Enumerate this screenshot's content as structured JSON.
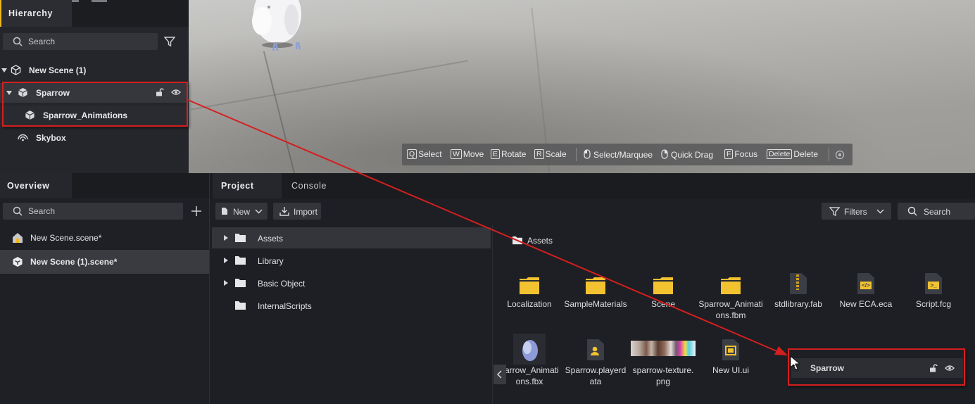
{
  "hierarchy": {
    "tab_label": "Hierarchy",
    "search_placeholder": "Search",
    "scene_root": "New Scene (1)",
    "items": [
      {
        "label": "Sparrow",
        "icon": "cube-icon",
        "expanded": true
      },
      {
        "label": "Sparrow_Animations",
        "icon": "cube-icon"
      },
      {
        "label": "Skybox",
        "icon": "skybox-icon"
      }
    ]
  },
  "scene_toolbar": {
    "items": [
      {
        "key": "Q",
        "label": "Select"
      },
      {
        "key": "W",
        "label": "Move"
      },
      {
        "key": "E",
        "label": "Rotate"
      },
      {
        "key": "R",
        "label": "Scale"
      },
      {
        "key": "",
        "label": "Select/Marquee",
        "icon": "mouse-left-icon"
      },
      {
        "key": "",
        "label": "Quick Drag",
        "icon": "mouse-right-icon"
      },
      {
        "key": "F",
        "label": "Focus"
      },
      {
        "key": "Delete",
        "label": "Delete"
      }
    ]
  },
  "overview": {
    "tab_label": "Overview",
    "search_placeholder": "Search",
    "scenes": [
      {
        "label": "New Scene.scene*",
        "icon": "house-icon",
        "selected": false
      },
      {
        "label": "New Scene (1).scene*",
        "icon": "scene-cube-icon",
        "selected": true
      }
    ]
  },
  "project": {
    "tabs": [
      "Project",
      "Console"
    ],
    "new_label": "New",
    "import_label": "Import",
    "filters_label": "Filters",
    "search_label": "Search",
    "folders": [
      {
        "label": "Assets",
        "expandable": true,
        "selected": true
      },
      {
        "label": "Library",
        "expandable": true
      },
      {
        "label": "Basic Object",
        "expandable": true
      },
      {
        "label": "InternalScripts",
        "expandable": false
      }
    ],
    "breadcrumb": "Assets",
    "grid_row1": [
      {
        "label": "Localization",
        "icon": "folder-icon"
      },
      {
        "label": "SampleMaterials",
        "icon": "folder-icon"
      },
      {
        "label": "Scene",
        "icon": "folder-icon"
      },
      {
        "label": "Sparrow_Animati",
        "label2": "ons.fbm",
        "icon": "folder-icon"
      },
      {
        "label": "stdlibrary.fab",
        "icon": "zip-file-icon"
      },
      {
        "label": "New ECA.eca",
        "icon": "eca-file-icon"
      },
      {
        "label": "Script.fcg",
        "icon": "script-file-icon"
      }
    ],
    "grid_row2": [
      {
        "label": "parrow_Animati",
        "label2": "ons.fbx",
        "icon": "model-icon"
      },
      {
        "label": "Sparrow.playerd",
        "label2": "ata",
        "icon": "player-data-icon"
      },
      {
        "label": "sparrow-texture.",
        "label2": "png",
        "icon": "texture-thumbnail"
      },
      {
        "label": "New UI.ui",
        "icon": "ui-file-icon"
      }
    ]
  },
  "drag_ghost": {
    "label": "Sparrow"
  },
  "colors": {
    "accent": "#f0b820",
    "folder": "#f2c230",
    "annotation": "#d41f1f"
  }
}
